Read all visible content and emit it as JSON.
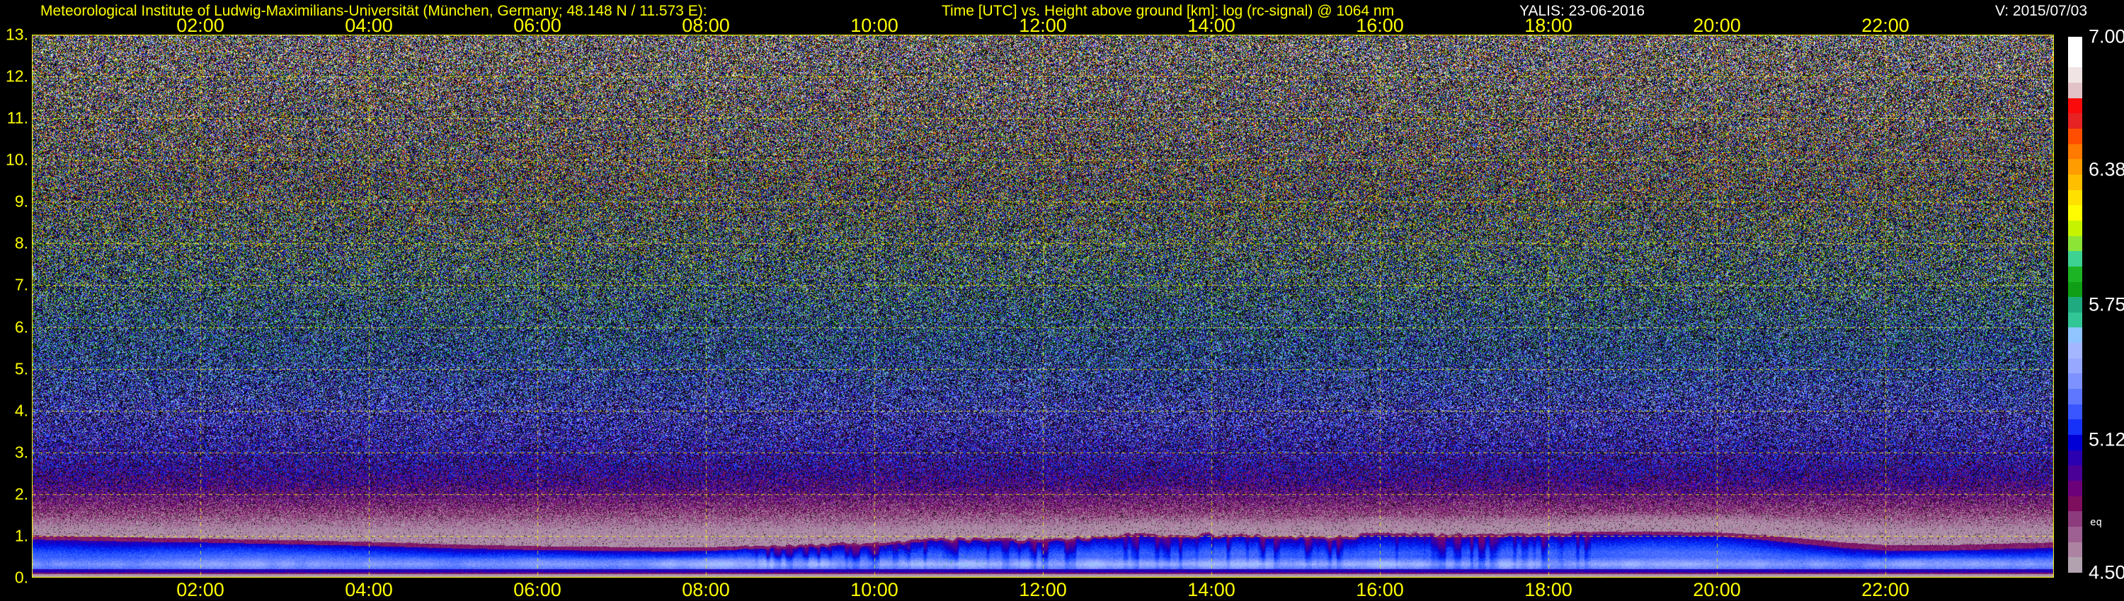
{
  "header": {
    "institute": "Meteorological Institute of Ludwig-Maximilians-Universität (München, Germany; 48.148 N / 11.573 E):",
    "title": "Time [UTC] vs. Height above ground [km]: log (rc-signal) @ 1064 nm",
    "system_date": "YALIS: 23-06-2016",
    "version": "V: 2015/07/03"
  },
  "colors": {
    "background": "#000000",
    "axis_text": "#FFFF00",
    "grid": "#FFFF00",
    "plot_border": "#FFFF00",
    "header_white": "#FFFFFF"
  },
  "chart_data": {
    "type": "heatmap",
    "title": "Time [UTC] vs. Height above ground [km]: log (rc-signal) @ 1064 nm",
    "xlabel": "Time [UTC]",
    "ylabel": "Height above ground [km]",
    "value_label": "log (rc-signal) @ 1064 nm",
    "x_range_hours": [
      0,
      24
    ],
    "x_tick_hours": [
      2,
      4,
      6,
      8,
      10,
      12,
      14,
      16,
      18,
      20,
      22
    ],
    "x_tick_labels": [
      "02:00",
      "04:00",
      "06:00",
      "08:00",
      "10:00",
      "12:00",
      "14:00",
      "16:00",
      "18:00",
      "20:00",
      "22:00"
    ],
    "y_range_km": [
      0,
      13
    ],
    "y_tick_km": [
      13,
      12,
      11,
      10,
      9,
      8,
      7,
      6,
      5,
      4,
      3,
      2,
      1,
      0
    ],
    "y_tick_labels": [
      "13.",
      "12.",
      "11.",
      "10.",
      "9.",
      "8.",
      "7.",
      "6.",
      "5.",
      "4.",
      "3.",
      "2.",
      "1.",
      "0."
    ],
    "grid": true,
    "colorbar": {
      "min": 4.5,
      "max": 7.0,
      "tick_labels": [
        "7.00",
        "6.38",
        "5.75",
        "5.12",
        "4.50"
      ],
      "tick_fractions": [
        0,
        0.248,
        0.5,
        0.752,
        1
      ],
      "unit_note": "eq",
      "cells_top_to_bottom": [
        "#FFFFFF",
        "#FFFFFF",
        "#F0E4E4",
        "#E2C2C6",
        "#FA0A0A",
        "#E62222",
        "#FF4E00",
        "#FF7A00",
        "#FF9C00",
        "#FFBE00",
        "#FFE000",
        "#FFFB00",
        "#C6F400",
        "#8CE436",
        "#3ED292",
        "#1CB424",
        "#0F9E16",
        "#1FAA80",
        "#32C696",
        "#8EC4FF",
        "#A4B6FF",
        "#96A8FF",
        "#7E92FF",
        "#5F76FF",
        "#3A56FF",
        "#1632F8",
        "#0000D6",
        "#2A00B0",
        "#4A0096",
        "#6C007A",
        "#7E0E5E",
        "#8C3C7C",
        "#9E6092",
        "#AC84A2",
        "#B2A2B0"
      ]
    },
    "boundary_layer_top_km": {
      "hours": [
        0,
        0.5,
        1,
        1.5,
        2,
        2.5,
        3,
        3.5,
        4,
        4.5,
        5,
        5.5,
        6,
        6.5,
        7,
        7.5,
        8,
        8.5,
        9,
        9.5,
        10,
        10.5,
        11,
        11.5,
        12,
        12.5,
        13,
        13.5,
        14,
        14.5,
        15,
        15.5,
        16,
        16.5,
        17,
        17.5,
        18,
        18.5,
        19,
        19.5,
        20,
        20.5,
        21,
        21.5,
        22,
        22.5,
        23,
        23.5,
        24
      ],
      "values": [
        0.92,
        0.9,
        0.88,
        0.86,
        0.85,
        0.83,
        0.81,
        0.79,
        0.77,
        0.74,
        0.71,
        0.69,
        0.67,
        0.66,
        0.65,
        0.64,
        0.65,
        0.67,
        0.7,
        0.73,
        0.77,
        0.81,
        0.84,
        0.87,
        0.9,
        0.92,
        0.94,
        0.95,
        0.96,
        0.97,
        0.97,
        0.97,
        0.98,
        0.99,
        1.0,
        1.0,
        1.01,
        1.02,
        1.03,
        1.02,
        1.0,
        0.92,
        0.82,
        0.72,
        0.66,
        0.65,
        0.67,
        0.7,
        0.72
      ]
    },
    "render_model": {
      "palette_stops": [
        [
          4.5,
          "#B2A2B0"
        ],
        [
          4.57,
          "#AC86A4"
        ],
        [
          4.64,
          "#9E6292"
        ],
        [
          4.72,
          "#8C3E7C"
        ],
        [
          4.82,
          "#7C0E5E"
        ],
        [
          4.92,
          "#6C0078"
        ],
        [
          5.0,
          "#4C0096"
        ],
        [
          5.08,
          "#2C00B0"
        ],
        [
          5.16,
          "#0600D4"
        ],
        [
          5.24,
          "#0026F4"
        ],
        [
          5.32,
          "#1A48FF"
        ],
        [
          5.4,
          "#3C64FF"
        ],
        [
          5.48,
          "#5E7CFF"
        ],
        [
          5.56,
          "#7E96FF"
        ],
        [
          5.64,
          "#98ACFF"
        ],
        [
          5.72,
          "#AABEFF"
        ],
        [
          5.8,
          "#8EC6FF"
        ],
        [
          5.87,
          "#3CCE9A"
        ],
        [
          5.94,
          "#20B286"
        ],
        [
          6.02,
          "#129E48"
        ],
        [
          6.1,
          "#12AE12"
        ],
        [
          6.18,
          "#52C812"
        ],
        [
          6.26,
          "#92E424"
        ],
        [
          6.34,
          "#C8F400"
        ],
        [
          6.42,
          "#FFF000"
        ],
        [
          6.5,
          "#FFD200"
        ],
        [
          6.58,
          "#FFB200"
        ],
        [
          6.66,
          "#FF9000"
        ],
        [
          6.74,
          "#FF6600"
        ],
        [
          6.82,
          "#F42A10"
        ],
        [
          6.88,
          "#E41616"
        ],
        [
          6.93,
          "#E2C2C6"
        ],
        [
          6.97,
          "#F0E2E2"
        ],
        [
          7.0,
          "#FFFFFF"
        ]
      ],
      "ambient_profile": [
        [
          1.15,
          4.56,
          0.09,
          0.015
        ],
        [
          1.4,
          4.64,
          0.15,
          0.05
        ],
        [
          1.7,
          4.76,
          0.22,
          0.1
        ],
        [
          2.2,
          4.94,
          0.3,
          0.2
        ],
        [
          2.8,
          5.12,
          0.38,
          0.28
        ],
        [
          3.5,
          5.28,
          0.45,
          0.34
        ],
        [
          4.5,
          5.42,
          0.54,
          0.38
        ],
        [
          5.5,
          5.54,
          0.64,
          0.4
        ],
        [
          7.0,
          5.68,
          0.82,
          0.4
        ],
        [
          9.0,
          5.8,
          1.05,
          0.38
        ],
        [
          11.0,
          5.89,
          1.3,
          0.36
        ],
        [
          13.0,
          5.97,
          1.48,
          0.33
        ]
      ],
      "plume_amp": [
        [
          0,
          0
        ],
        [
          8,
          0
        ],
        [
          9,
          0.06
        ],
        [
          13,
          0.07
        ],
        [
          17,
          0.05
        ],
        [
          18.5,
          0.02
        ],
        [
          19.5,
          0
        ],
        [
          24,
          0
        ]
      ],
      "cap_thickness": [
        [
          0,
          0.1
        ],
        [
          8,
          0.09
        ],
        [
          9,
          0.06
        ],
        [
          18,
          0.06
        ],
        [
          20,
          0.09
        ],
        [
          21,
          0.13
        ],
        [
          24,
          0.13
        ]
      ],
      "gray_zone_depth": [
        [
          0,
          0.3
        ],
        [
          9,
          0.35
        ],
        [
          18,
          0.35
        ],
        [
          21,
          0.5
        ],
        [
          24,
          0.45
        ]
      ],
      "streak_strength": [
        [
          0,
          0.55
        ],
        [
          5,
          0.5
        ],
        [
          8,
          0.7
        ],
        [
          9,
          0.85
        ],
        [
          17,
          0.85
        ],
        [
          18,
          0.7
        ],
        [
          21,
          0.6
        ],
        [
          24,
          0.7
        ]
      ],
      "green_spot_window_hours": [
        10.1,
        11.35
      ],
      "surface_layers": [
        {
          "name": "overlap-gray-band",
          "h_top": 0.095,
          "value": 4.52
        },
        {
          "name": "maroon-line",
          "h_top": 0.13,
          "value": 4.8
        },
        {
          "name": "navy-band",
          "h_top": 0.21,
          "value": 5.09
        }
      ],
      "seed": 1234
    }
  }
}
